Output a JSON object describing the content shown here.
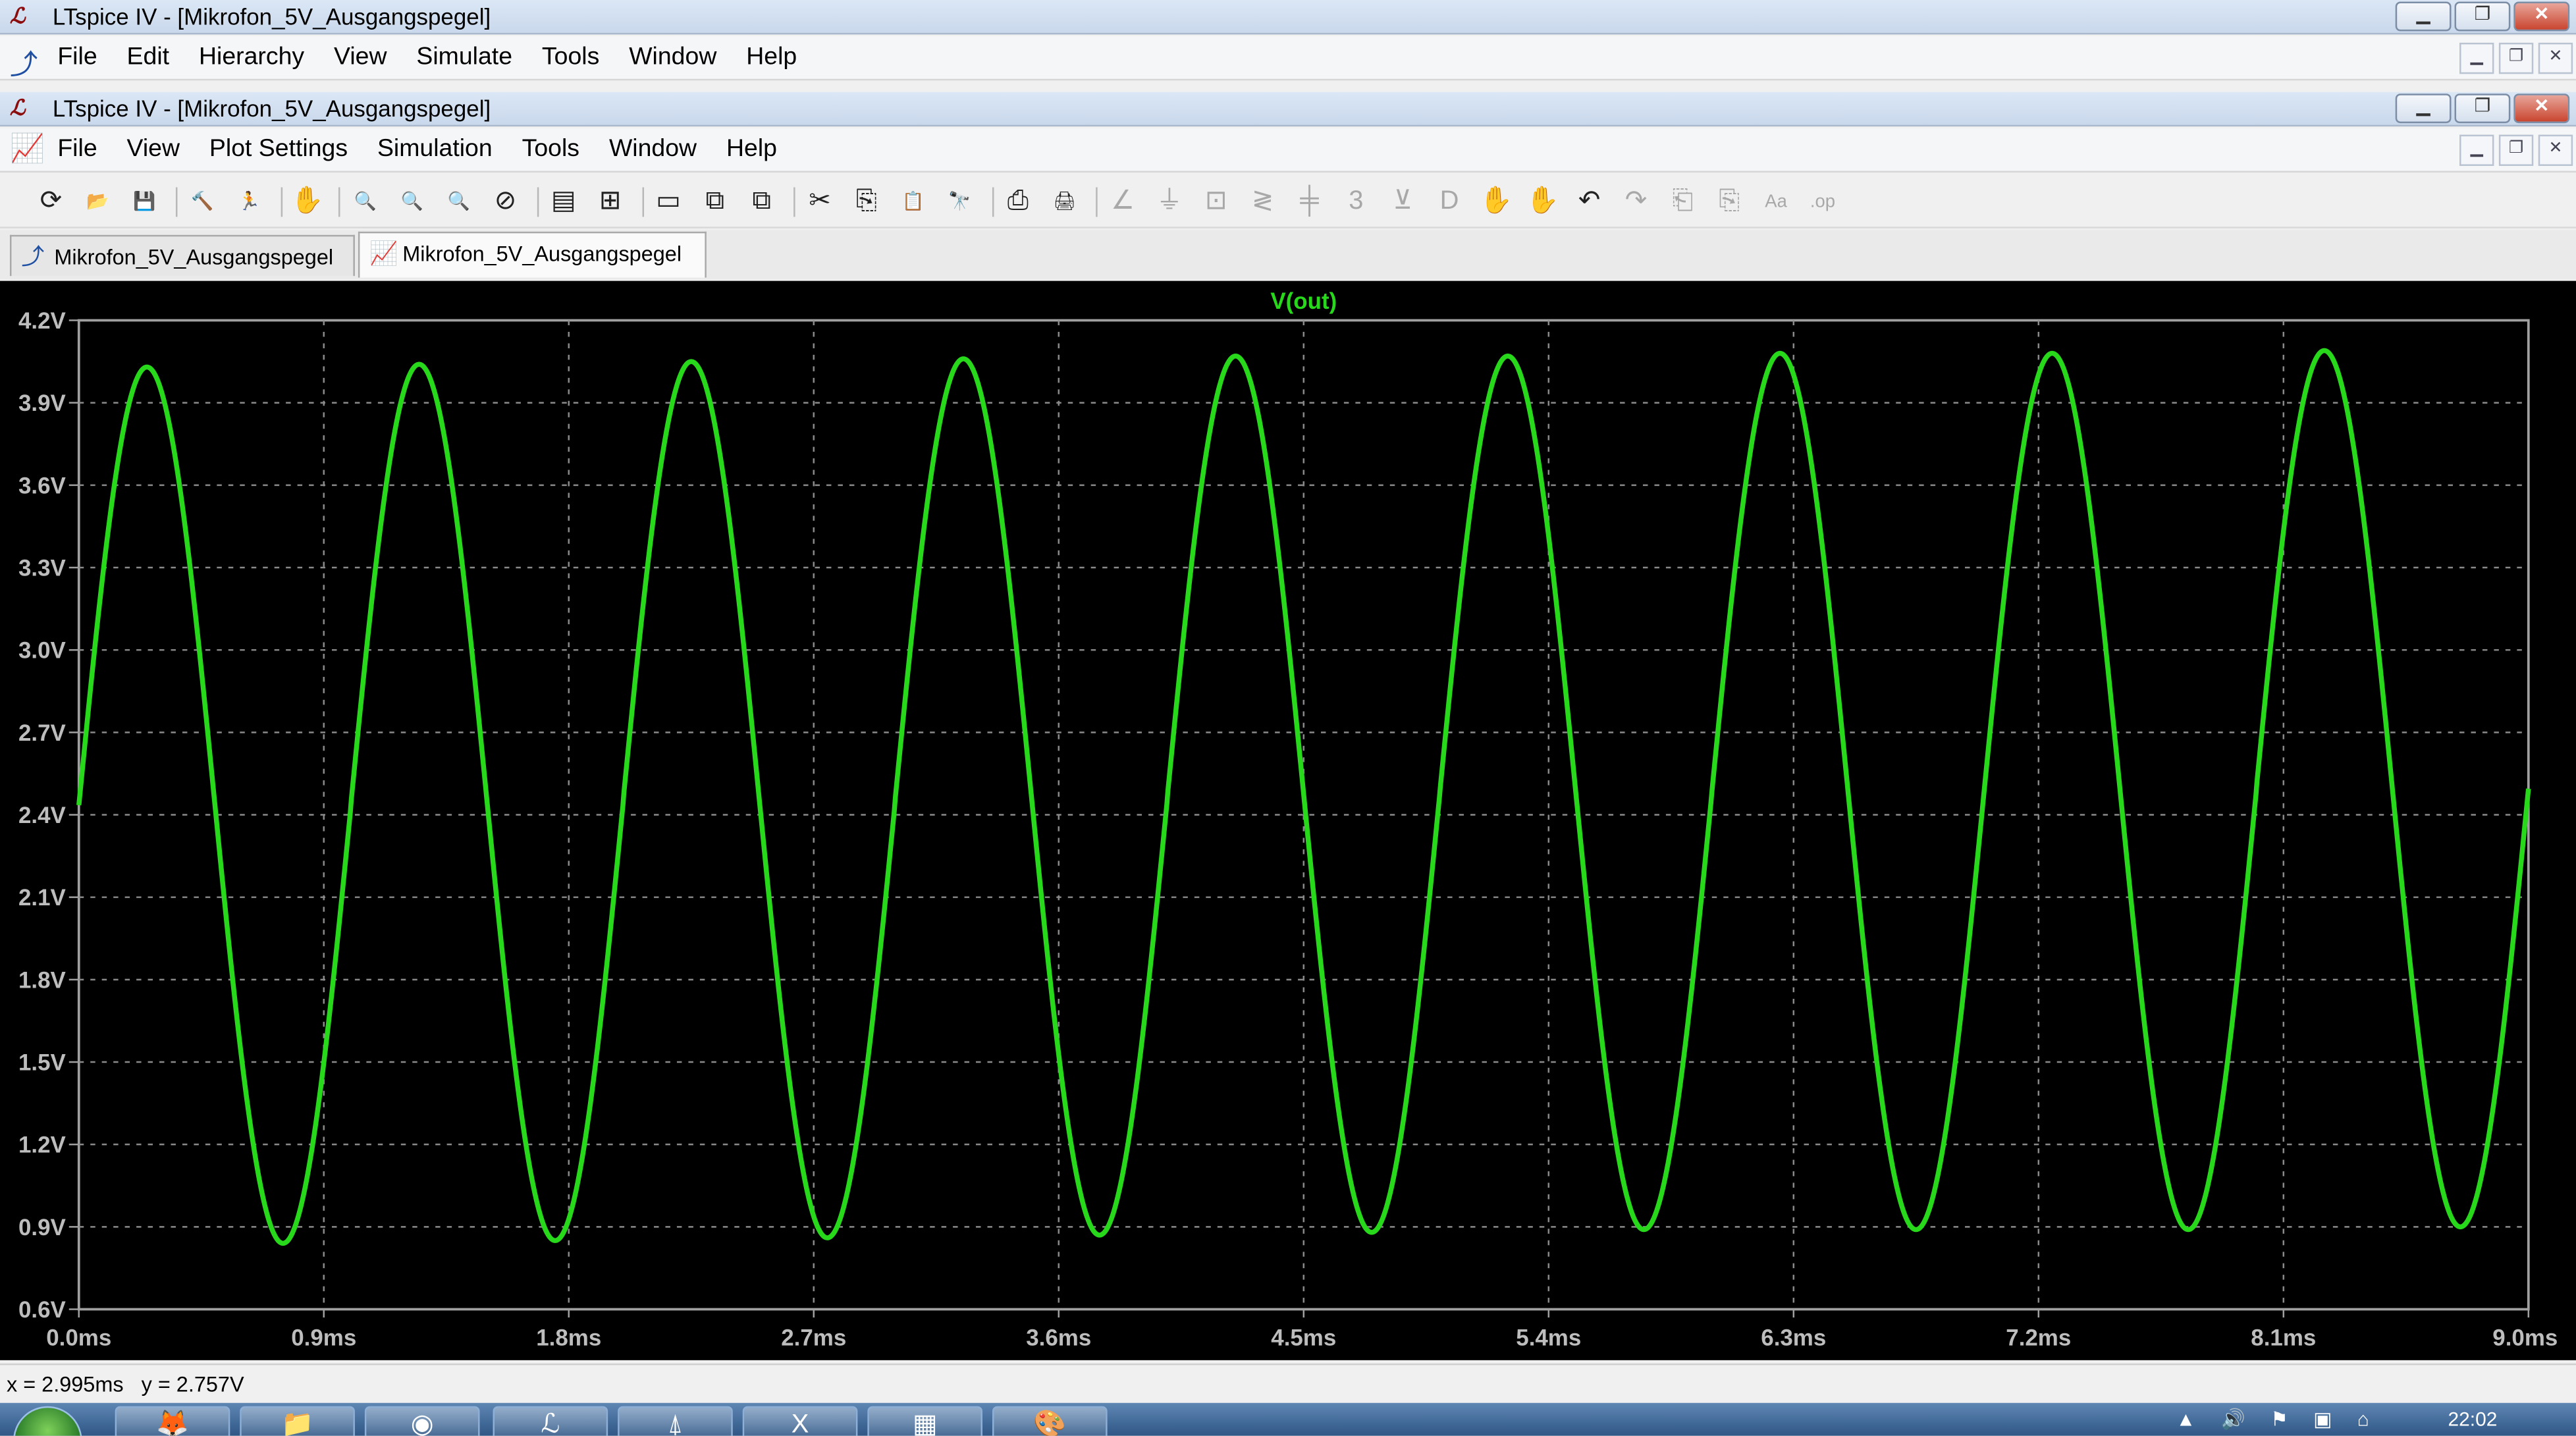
{
  "window": {
    "title": "LTspice IV - [Mikrofon_5V_Ausgangspegel]",
    "app_icon": "ltspice-logo-icon",
    "buttons": [
      "minimize-icon",
      "restore-icon",
      "close-icon"
    ]
  },
  "schematic_menu": {
    "items": [
      "File",
      "Edit",
      "Hierarchy",
      "View",
      "Simulate",
      "Tools",
      "Window",
      "Help"
    ]
  },
  "inner_window": {
    "title": "LTspice IV - [Mikrofon_5V_Ausgangspegel]"
  },
  "waveform_menu": {
    "items": [
      "File",
      "View",
      "Plot Settings",
      "Simulation",
      "Tools",
      "Window",
      "Help"
    ]
  },
  "toolbar": {
    "buttons": [
      {
        "name": "run-icon",
        "glyph": "⟳",
        "enabled": true
      },
      {
        "name": "open-icon",
        "glyph": "📂",
        "enabled": true
      },
      {
        "name": "save-icon",
        "glyph": "💾",
        "enabled": true
      },
      {
        "name": "control-panel-icon",
        "glyph": "🔨",
        "enabled": true
      },
      {
        "name": "run-simulation-icon",
        "glyph": "🏃",
        "enabled": true
      },
      {
        "name": "pan-icon",
        "glyph": "✋",
        "enabled": false
      },
      {
        "name": "zoom-area-icon",
        "glyph": "🔍",
        "enabled": true
      },
      {
        "name": "zoom-in-icon",
        "glyph": "🔍",
        "enabled": true
      },
      {
        "name": "zoom-out-icon",
        "glyph": "🔍",
        "enabled": true
      },
      {
        "name": "zoom-fit-icon",
        "glyph": "⊘",
        "enabled": true
      },
      {
        "name": "autorange-icon",
        "glyph": "▤",
        "enabled": true
      },
      {
        "name": "add-trace-icon",
        "glyph": "⊞",
        "enabled": true
      },
      {
        "name": "tile-horizontal-icon",
        "glyph": "▭",
        "enabled": true
      },
      {
        "name": "cascade-icon",
        "glyph": "⧉",
        "enabled": true
      },
      {
        "name": "tile-vertical-icon",
        "glyph": "⧉",
        "enabled": true
      },
      {
        "name": "cut-icon",
        "glyph": "✂",
        "enabled": true
      },
      {
        "name": "copy-icon",
        "glyph": "⎘",
        "enabled": true
      },
      {
        "name": "paste-icon",
        "glyph": "📋",
        "enabled": true
      },
      {
        "name": "find-icon",
        "glyph": "🔭",
        "enabled": true
      },
      {
        "name": "print-setup-icon",
        "glyph": "⎙",
        "enabled": true
      },
      {
        "name": "print-icon",
        "glyph": "🖨",
        "enabled": true
      },
      {
        "name": "wire-icon",
        "glyph": "∠",
        "enabled": false
      },
      {
        "name": "ground-icon",
        "glyph": "⏚",
        "enabled": false
      },
      {
        "name": "label-net-icon",
        "glyph": "⊡",
        "enabled": false
      },
      {
        "name": "resistor-icon",
        "glyph": "≷",
        "enabled": false
      },
      {
        "name": "capacitor-icon",
        "glyph": "╪",
        "enabled": false
      },
      {
        "name": "inductor-icon",
        "glyph": "3",
        "enabled": false
      },
      {
        "name": "diode-icon",
        "glyph": "⊻",
        "enabled": false
      },
      {
        "name": "component-icon",
        "glyph": "D",
        "enabled": false
      },
      {
        "name": "move-icon",
        "glyph": "✋",
        "enabled": false
      },
      {
        "name": "drag-icon",
        "glyph": "✋",
        "enabled": false
      },
      {
        "name": "undo-icon",
        "glyph": "↶",
        "enabled": true
      },
      {
        "name": "redo-icon",
        "glyph": "↷",
        "enabled": false
      },
      {
        "name": "rotate-icon",
        "glyph": "⎗",
        "enabled": false
      },
      {
        "name": "mirror-icon",
        "glyph": "⎘",
        "enabled": false
      },
      {
        "name": "text-icon",
        "glyph": "Aa",
        "enabled": false
      },
      {
        "name": "spice-directive-icon",
        "glyph": ".op",
        "enabled": false
      }
    ]
  },
  "tabs": [
    {
      "label": "Mikrofon_5V_Ausgangspegel",
      "icon": "schematic-icon",
      "active": false
    },
    {
      "label": "Mikrofon_5V_Ausgangspegel",
      "icon": "waveform-icon",
      "active": true
    }
  ],
  "plot": {
    "background": "#000000",
    "trace_color": "#27d81b",
    "grid_color": "#8a8a8a",
    "axis_text_color": "#bdbdbd"
  },
  "chart_data": {
    "type": "line",
    "title": "",
    "series": [
      {
        "name": "V(out)",
        "offset": 2.45,
        "amplitude_start": 1.6,
        "amplitude_end": 1.6,
        "frequency_khz": 1.0,
        "phase_deg": 0,
        "peaks": [
          4.03,
          4.04,
          4.05,
          4.06,
          4.07,
          4.07,
          4.08,
          4.08,
          4.09
        ],
        "troughs": [
          0.84,
          0.85,
          0.86,
          0.87,
          0.88,
          0.89,
          0.89,
          0.89,
          0.9
        ],
        "start_value": 2.13,
        "end_value": 2.2
      }
    ],
    "x_unit": "ms",
    "xlim": [
      0,
      9
    ],
    "ylim": [
      0.6,
      4.2
    ],
    "x_ticks": [
      "0.0ms",
      "0.9ms",
      "1.8ms",
      "2.7ms",
      "3.6ms",
      "4.5ms",
      "5.4ms",
      "6.3ms",
      "7.2ms",
      "8.1ms",
      "9.0ms"
    ],
    "y_ticks": [
      "4.2V",
      "3.9V",
      "3.6V",
      "3.3V",
      "3.0V",
      "2.7V",
      "2.4V",
      "2.1V",
      "1.8V",
      "1.5V",
      "1.2V",
      "0.9V",
      "0.6V"
    ],
    "grid": true
  },
  "status": {
    "cursor_text": "x = 2.995ms   y = 2.757V"
  },
  "taskbar": {
    "start": "windows-start-icon",
    "apps": [
      {
        "name": "firefox-icon",
        "glyph": "🦊"
      },
      {
        "name": "explorer-icon",
        "glyph": "📁"
      },
      {
        "name": "chrome-icon",
        "glyph": "◉"
      },
      {
        "name": "ltspice-task-icon",
        "glyph": "ℒ"
      },
      {
        "name": "acrobat-icon",
        "glyph": "⍋"
      },
      {
        "name": "excel-icon",
        "glyph": "X"
      },
      {
        "name": "calc-icon",
        "glyph": "▦"
      },
      {
        "name": "paint-icon",
        "glyph": "🎨"
      }
    ],
    "clock": "22:02"
  }
}
